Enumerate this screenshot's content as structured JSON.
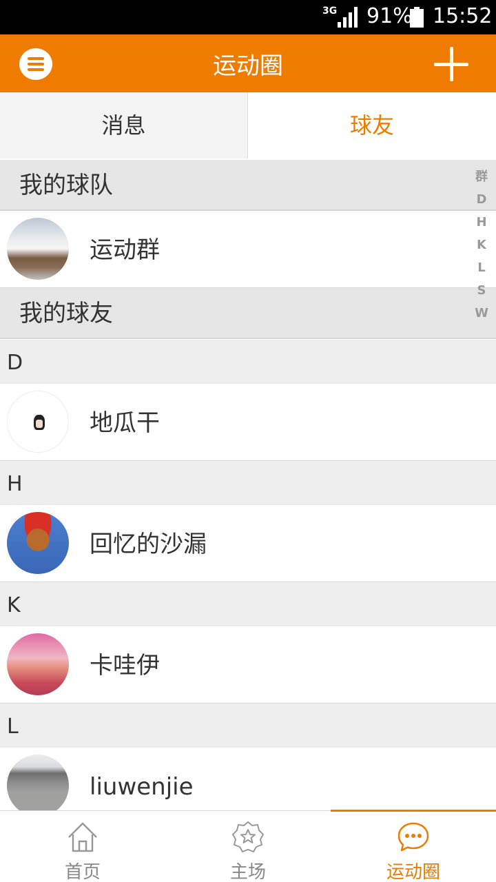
{
  "status_bar": {
    "network": "3G",
    "battery_percent": "91%",
    "time": "15:52"
  },
  "header": {
    "title": "运动圈",
    "menu_icon": "menu-list-icon",
    "add_icon": "plus-icon",
    "accent_color": "#ef7b00"
  },
  "tabs": [
    {
      "label": "消息",
      "active": false
    },
    {
      "label": "球友",
      "active": true
    }
  ],
  "sections": {
    "teams_header": "我的球队",
    "friends_header": "我的球友"
  },
  "teams": [
    {
      "name": "运动群",
      "avatar": "group-photo"
    }
  ],
  "friends": [
    {
      "letter": "D",
      "name": "地瓜干",
      "avatar": "cartoon-figure"
    },
    {
      "letter": "H",
      "name": "回忆的沙漏",
      "avatar": "bear-photo"
    },
    {
      "letter": "K",
      "name": "卡哇伊",
      "avatar": "pink-sky-photo"
    },
    {
      "letter": "L",
      "name": "liuwenjie",
      "avatar": "laptop-photo"
    }
  ],
  "side_index": [
    "群",
    "D",
    "H",
    "K",
    "L",
    "S",
    "W"
  ],
  "bottom_nav": [
    {
      "label": "首页",
      "icon": "home-icon",
      "active": false
    },
    {
      "label": "主场",
      "icon": "star-badge-icon",
      "active": false
    },
    {
      "label": "运动圈",
      "icon": "chat-bubble-icon",
      "active": true
    }
  ]
}
